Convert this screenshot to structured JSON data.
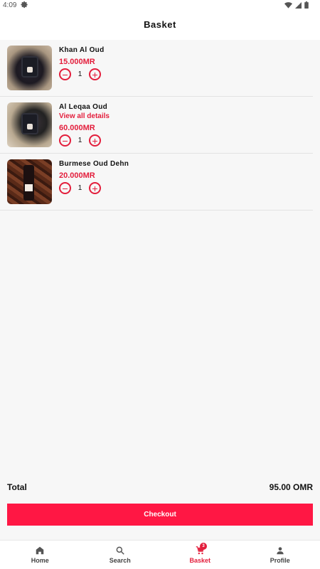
{
  "status_bar": {
    "time": "4:09"
  },
  "header": {
    "title": "Basket"
  },
  "basket": {
    "items": [
      {
        "name": "Khan Al Oud",
        "details_link": "",
        "price": "15.000MR",
        "quantity": "1"
      },
      {
        "name": "Al Leqaa Oud",
        "details_link": "View all details",
        "price": "60.000MR",
        "quantity": "1"
      },
      {
        "name": "Burmese Oud Dehn",
        "details_link": "",
        "price": "20.000MR",
        "quantity": "1"
      }
    ]
  },
  "summary": {
    "total_label": "Total",
    "total_value": "95.00 OMR"
  },
  "checkout": {
    "label": "Checkout"
  },
  "bottom_nav": {
    "items": [
      {
        "label": "Home",
        "icon": "home-icon"
      },
      {
        "label": "Search",
        "icon": "search-icon"
      },
      {
        "label": "Basket",
        "icon": "cart-icon",
        "badge": "3",
        "active": true
      },
      {
        "label": "Profile",
        "icon": "person-icon"
      }
    ]
  },
  "colors": {
    "accent": "#e31e3c",
    "checkout_bg": "#ff1744",
    "background": "#f7f7f7"
  }
}
